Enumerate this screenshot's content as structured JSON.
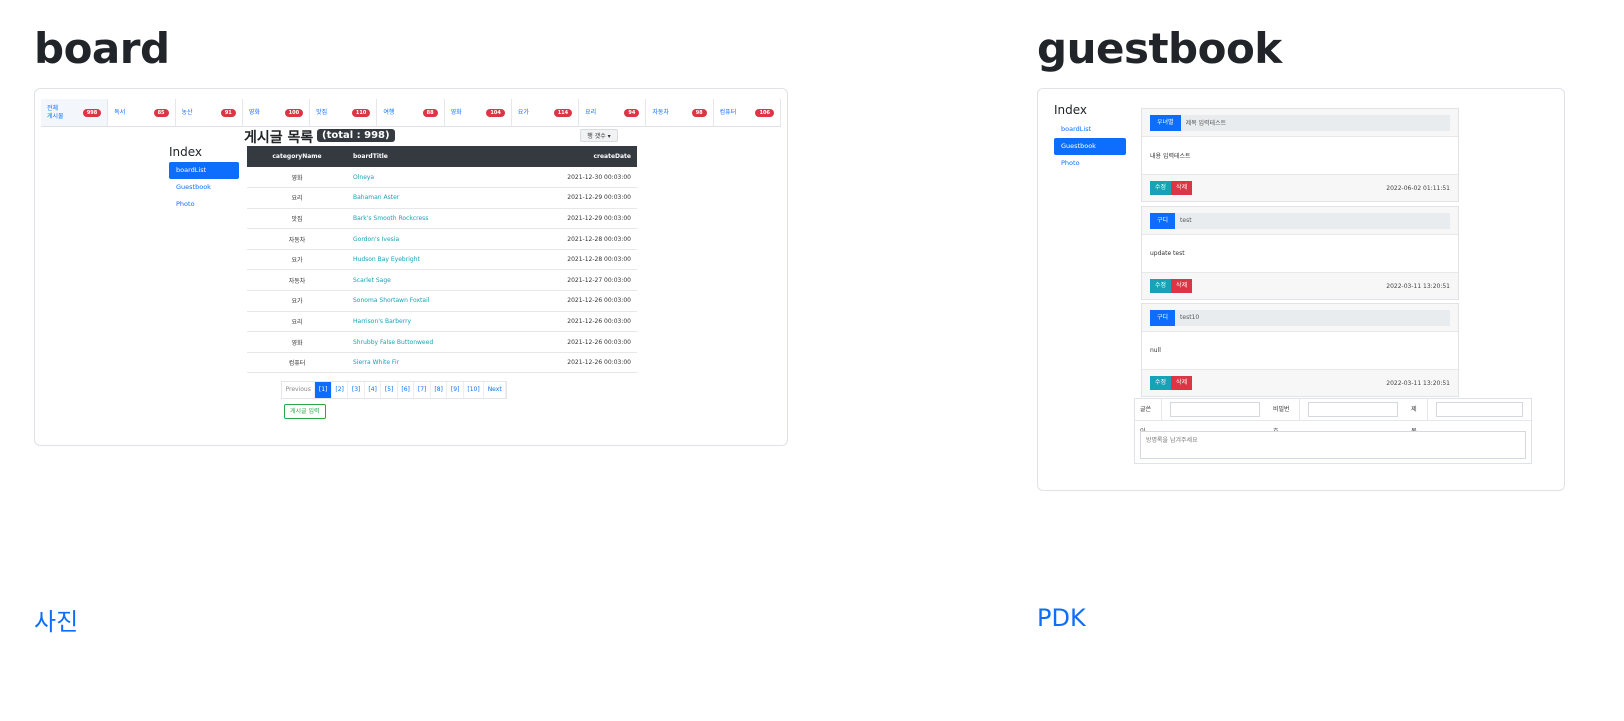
{
  "sections": {
    "board_title": "board",
    "guestbook_title": "guestbook",
    "photo_link": "사진",
    "pdk_link": "PDK"
  },
  "board": {
    "categories": [
      {
        "label": "전체\n게시물",
        "count": "998"
      },
      {
        "label": "독서",
        "count": "85"
      },
      {
        "label": "농산",
        "count": "91"
      },
      {
        "label": "영화",
        "count": "100"
      },
      {
        "label": "맛집",
        "count": "110"
      },
      {
        "label": "여행",
        "count": "88"
      },
      {
        "label": "영화",
        "count": "104"
      },
      {
        "label": "요가",
        "count": "114"
      },
      {
        "label": "요리",
        "count": "94"
      },
      {
        "label": "자동차",
        "count": "98"
      },
      {
        "label": "컴퓨터",
        "count": "106"
      }
    ],
    "heading": "게시글 목록",
    "total": "(total : 998)",
    "rows_button": "행 갯수 ▾",
    "index": {
      "title": "Index",
      "items": [
        "boardList",
        "Guestbook",
        "Photo"
      ]
    },
    "table": {
      "headers": [
        "categoryName",
        "boardTitle",
        "createDate"
      ],
      "rows": [
        [
          "영화",
          "Olneya",
          "2021-12-30 00:03:00"
        ],
        [
          "요리",
          "Bahaman Aster",
          "2021-12-29 00:03:00"
        ],
        [
          "맛집",
          "Bark's Smooth Rockcress",
          "2021-12-29 00:03:00"
        ],
        [
          "자동차",
          "Gordon's Ivesia",
          "2021-12-28 00:03:00"
        ],
        [
          "요가",
          "Hudson Bay Eyebright",
          "2021-12-28 00:03:00"
        ],
        [
          "자동차",
          "Scarlet Sage",
          "2021-12-27 00:03:00"
        ],
        [
          "요가",
          "Sonoma Shortawn Foxtail",
          "2021-12-26 00:03:00"
        ],
        [
          "요리",
          "Harrison's Barberry",
          "2021-12-26 00:03:00"
        ],
        [
          "영화",
          "Shrubby False Buttonweed",
          "2021-12-26 00:03:00"
        ],
        [
          "컴퓨터",
          "Sierra White Fir",
          "2021-12-26 00:03:00"
        ]
      ]
    },
    "pager": [
      "Previous",
      "[1]",
      "[2]",
      "[3]",
      "[4]",
      "[5]",
      "[6]",
      "[7]",
      "[8]",
      "[9]",
      "[10]",
      "Next"
    ],
    "write_button": "게시글 입력"
  },
  "guestbook": {
    "index": {
      "title": "Index",
      "items": [
        "boardList",
        "Guestbook",
        "Photo"
      ]
    },
    "entries": [
      {
        "name": "우녀별",
        "subject": "제목 입력테스트",
        "content": "내용 입력테스트",
        "edit": "수정",
        "delete": "삭제",
        "date": "2022-06-02 01:11:51"
      },
      {
        "name": "구디",
        "subject": "test",
        "content": "update test",
        "edit": "수정",
        "delete": "삭제",
        "date": "2022-03-11 13:20:51"
      },
      {
        "name": "구디",
        "subject": "test10",
        "content": "null",
        "edit": "수정",
        "delete": "삭제",
        "date": "2022-03-11 13:20:51"
      }
    ],
    "form": {
      "writer_label": "글쓴이",
      "password_label": "비밀번호",
      "subject_label": "제목",
      "content_placeholder": "방명록을 남겨주세요"
    }
  },
  "colors": {
    "primary": "#0d6efd",
    "danger": "#dc3545",
    "info": "#17a2b8",
    "success": "#28a745",
    "dark": "#343a40"
  }
}
